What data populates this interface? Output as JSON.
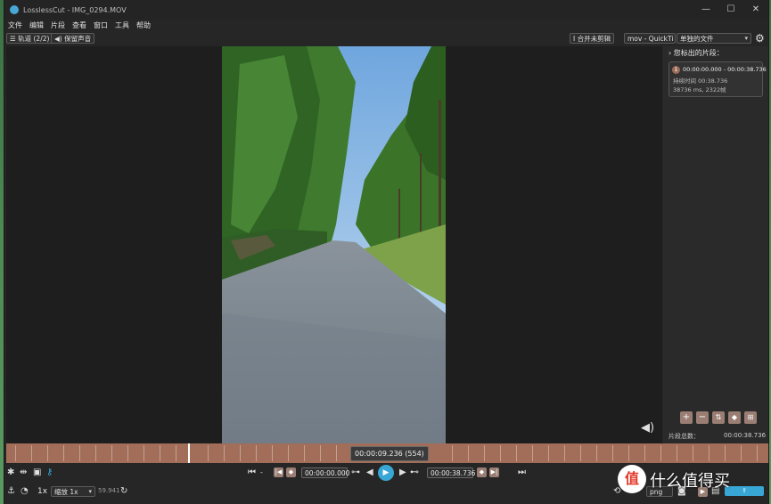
{
  "window": {
    "title": "LosslessCut - IMG_0294.MOV",
    "controls": {
      "minimize": "—",
      "maximize": "☐",
      "close": "✕"
    }
  },
  "menu": [
    "文件",
    "编辑",
    "片段",
    "查看",
    "窗口",
    "工具",
    "帮助"
  ],
  "toolbar": {
    "tracks_label": "轨道 (2/2)",
    "keep_audio_label": "保留声音",
    "merge_label": "I 合并未剪辑",
    "format_value": "mov - QuickTi",
    "output_value": "单独的文件"
  },
  "sidebar": {
    "header": "您标出的片段：",
    "segment": {
      "number": "1",
      "range": "00:00:00.000 - 00:00:38.736",
      "duration": "持续时间 00:38.736",
      "frames": "38736 ms, 2322帧"
    },
    "total_label": "片段总数：",
    "total_value": "00:00:38.736"
  },
  "timeline": {
    "current_time": "00:00:09.236 (554)"
  },
  "controls": {
    "start_time": "00:00:00.000",
    "end_time": "00:00:38.736",
    "speed": "1x",
    "zoom_select": "缩放 1x",
    "fps": "59.941",
    "format_png": "png"
  },
  "watermark": {
    "logo_char": "值",
    "text": "什么值得买"
  },
  "colors": {
    "accent": "#38a7d6",
    "timeline": "#a26e5a",
    "button": "#9a7e73"
  }
}
